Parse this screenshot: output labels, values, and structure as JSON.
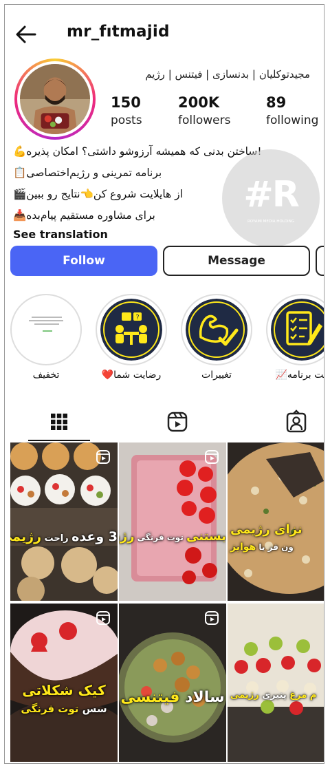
{
  "header": {
    "username": "mr_fıtmajid"
  },
  "profile": {
    "full_name": "مجیدتوکلیان | بدنسازی | فیتنس | رژیم",
    "stats": [
      {
        "value": "150",
        "label": "posts"
      },
      {
        "value": "200K",
        "label": "followers"
      },
      {
        "value": "89",
        "label": "following"
      }
    ],
    "bio": [
      "!ساختن بدنی که همیشه آرزوشو داشتی؟ امکان پذیره💪",
      "برنامه تمرینی و رژیم‌اختصاصی📋",
      "از هایلایت شروع کن👈نتایج رو ببین🎬",
      "برای مشاوره مستقیم پیام‌بده📥"
    ],
    "see_translation": "See translation"
  },
  "watermark": {
    "text": "#R",
    "sub": "ROYAMI MEDIA HOLDING"
  },
  "actions": {
    "follow": "Follow",
    "message": "Message"
  },
  "highlights": [
    {
      "label": "تخفیف",
      "icon": "discount-note-icon"
    },
    {
      "label": "رضایت شما❤️",
      "icon": "meeting-icon"
    },
    {
      "label": "تغییرات",
      "icon": "muscle-check-icon"
    },
    {
      "label": "فت برنامه📈",
      "icon": "checklist-icon"
    }
  ],
  "tabs": [
    {
      "name": "grid",
      "icon": "grid-icon"
    },
    {
      "name": "reels",
      "icon": "reels-icon"
    },
    {
      "name": "tagged",
      "icon": "tagged-icon"
    }
  ],
  "posts": [
    {
      "caption_main": "3 وعده",
      "caption_mid": " راحت ",
      "caption_accent": "رژیمی"
    },
    {
      "caption_main": "بستنی",
      "caption_mid": " توت فرنگی ",
      "caption_accent": "رژیمی"
    },
    {
      "caption_main": "نزای رژیمی",
      "caption_mid": "ون فر یا ",
      "caption_accent": "هوایز"
    },
    {
      "caption_main": "کیک شکلاتی",
      "caption_mid": "سس ",
      "caption_accent": "توت فرنگی"
    },
    {
      "caption_main": "سالاد ",
      "caption_mid": "",
      "caption_accent": "فیتنسی"
    },
    {
      "caption_main": "م مرغ ",
      "caption_mid": "پنیری ",
      "caption_accent": "رژیمی"
    }
  ],
  "colors": {
    "follow_button": "#4a65f5",
    "accent_yellow": "#ffe81a",
    "highlight_navy": "#1f2a44"
  }
}
